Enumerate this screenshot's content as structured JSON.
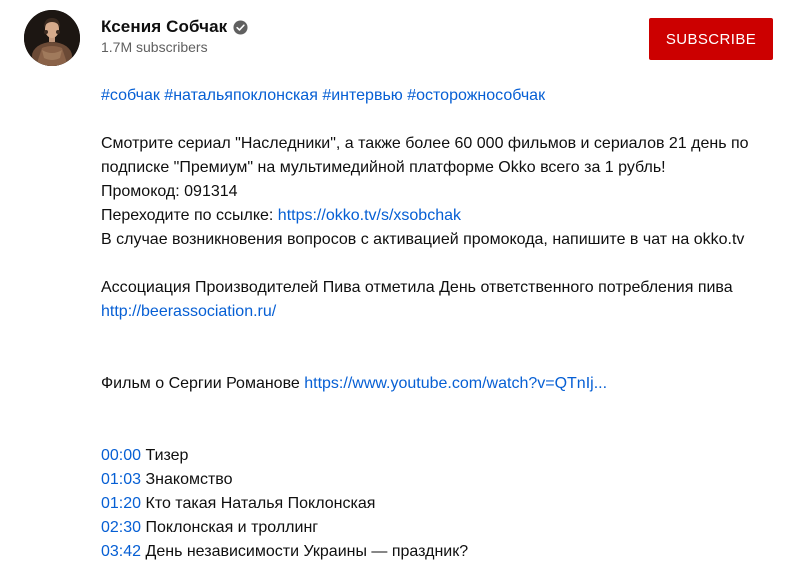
{
  "channel": {
    "name": "Ксения Собчак",
    "subscribers": "1.7M subscribers",
    "subscribe_label": "SUBSCRIBE"
  },
  "description": {
    "hashtags": [
      "#собчак",
      "#натальяпоклонская",
      "#интервью",
      "#осторожнособчак"
    ],
    "promo_line_1": "Смотрите сериал \"Наследники\", а также более 60 000 фильмов и сериалов 21 день по",
    "promo_line_2": "подписке \"Премиум\" на мультимедийной платформе Okko всего за 1 рубль!",
    "promo_code": "Промокод: 091314",
    "link_prefix": "Переходите по ссылке: ",
    "okko_link": "https://okko.tv/s/xsobchak",
    "support_line": "В случае возникновения вопросов с активацией промокода, напишите в чат на okko.tv",
    "beer_line": "Ассоциация Производителей Пива отметила День ответственного потребления пива",
    "beer_link": "http://beerassociation.ru/",
    "film_prefix": "Фильм о Сергии Романове ",
    "film_link": "https://www.youtube.com/watch?v=QTnIj...",
    "chapters": [
      {
        "time": "00:00",
        "title": " Тизер"
      },
      {
        "time": "01:03",
        "title": " Знакомство"
      },
      {
        "time": "01:20",
        "title": " Кто такая Наталья Поклонская"
      },
      {
        "time": "02:30",
        "title": " Поклонская и троллинг"
      },
      {
        "time": "03:42",
        "title": " День независимости Украины — праздник?"
      }
    ]
  },
  "colors": {
    "subscribe_bg": "#cc0000",
    "link": "#065fd4",
    "secondary_text": "#606060"
  }
}
